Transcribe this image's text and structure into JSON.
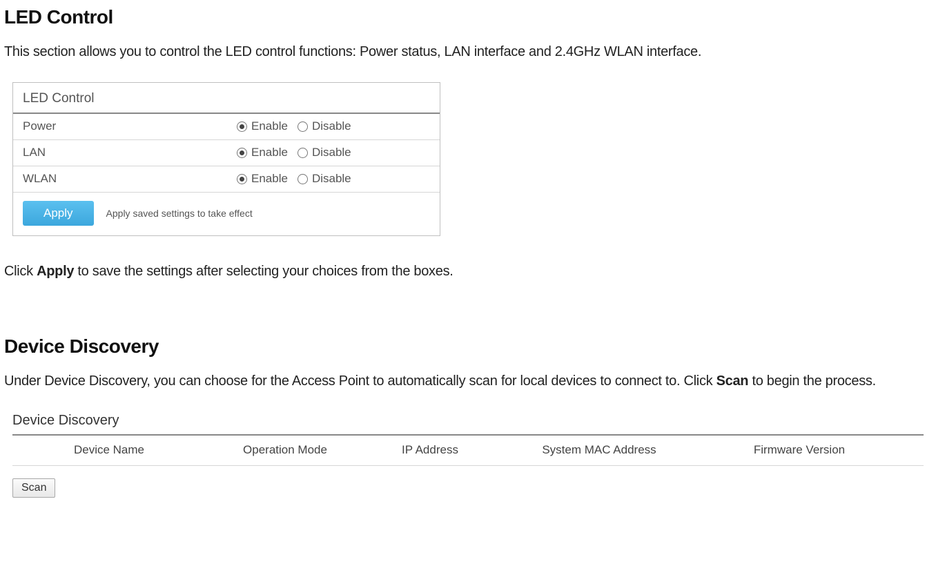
{
  "led_section": {
    "title": "LED Control",
    "description": "This section allows you to control the LED control functions: Power status, LAN interface and 2.4GHz WLAN interface.",
    "panel_title": "LED Control",
    "rows": [
      {
        "label": "Power",
        "enable": "Enable",
        "disable": "Disable",
        "selected": "enable"
      },
      {
        "label": "LAN",
        "enable": "Enable",
        "disable": "Disable",
        "selected": "enable"
      },
      {
        "label": "WLAN",
        "enable": "Enable",
        "disable": "Disable",
        "selected": "enable"
      }
    ],
    "apply_button": "Apply",
    "apply_caption": "Apply saved settings to take effect",
    "footer_line_before": "Click ",
    "footer_bold": "Apply",
    "footer_line_after": " to save the settings after selecting your choices from the boxes."
  },
  "dd_section": {
    "title": "Device Discovery",
    "description_before": "Under Device Discovery, you can choose for the Access Point to automatically scan for local devices to connect to. Click ",
    "description_bold": "Scan",
    "description_after": " to begin the process.",
    "panel_title": "Device Discovery",
    "columns": {
      "c1": "Device Name",
      "c2": "Operation Mode",
      "c3": "IP Address",
      "c4": "System MAC Address",
      "c5": "Firmware Version"
    },
    "scan_button": "Scan"
  }
}
